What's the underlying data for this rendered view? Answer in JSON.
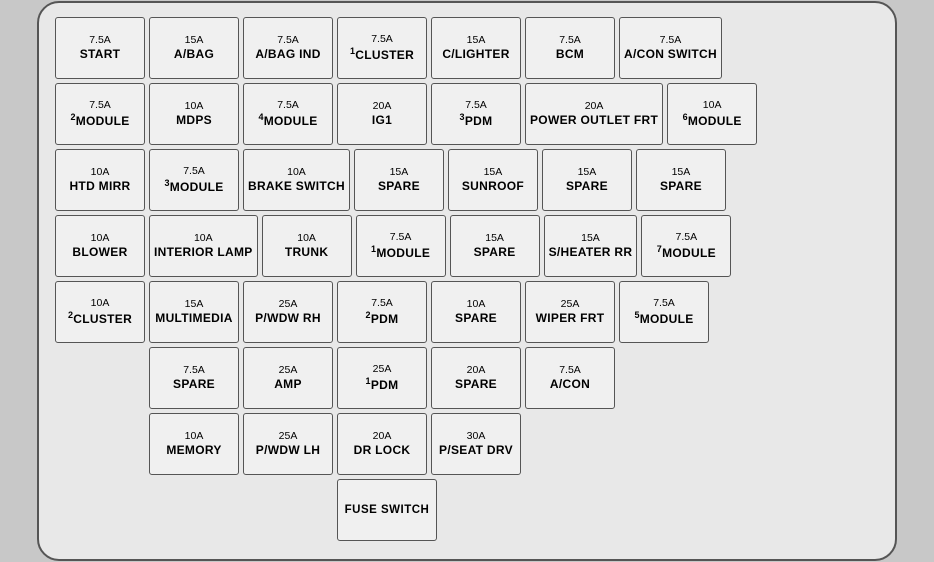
{
  "rows": [
    {
      "offset": 0,
      "cells": [
        {
          "amps": "7.5A",
          "label": "START",
          "sup": ""
        },
        {
          "amps": "15A",
          "label": "A/BAG",
          "sup": ""
        },
        {
          "amps": "7.5A",
          "label": "A/BAG IND",
          "sup": ""
        },
        {
          "amps": "7.5A",
          "label": "CLUSTER",
          "sup": "1"
        },
        {
          "amps": "15A",
          "label": "C/LIGHTER",
          "sup": ""
        },
        {
          "amps": "7.5A",
          "label": "BCM",
          "sup": ""
        },
        {
          "amps": "7.5A",
          "label": "A/CON SWITCH",
          "sup": ""
        }
      ]
    },
    {
      "offset": 0,
      "cells": [
        {
          "amps": "7.5A",
          "label": "MODULE",
          "sup": "2"
        },
        {
          "amps": "10A",
          "label": "MDPS",
          "sup": ""
        },
        {
          "amps": "7.5A",
          "label": "MODULE",
          "sup": "4"
        },
        {
          "amps": "20A",
          "label": "IG1",
          "sup": ""
        },
        {
          "amps": "7.5A",
          "label": "PDM",
          "sup": "3"
        },
        {
          "amps": "20A",
          "label": "POWER OUTLET FRT",
          "sup": ""
        },
        {
          "amps": "10A",
          "label": "MODULE",
          "sup": "6"
        }
      ]
    },
    {
      "offset": 0,
      "cells": [
        {
          "amps": "10A",
          "label": "HTD MIRR",
          "sup": ""
        },
        {
          "amps": "7.5A",
          "label": "MODULE",
          "sup": "3"
        },
        {
          "amps": "10A",
          "label": "BRAKE SWITCH",
          "sup": ""
        },
        {
          "amps": "15A",
          "label": "SPARE",
          "sup": ""
        },
        {
          "amps": "15A",
          "label": "SUNROOF",
          "sup": ""
        },
        {
          "amps": "15A",
          "label": "SPARE",
          "sup": ""
        },
        {
          "amps": "15A",
          "label": "SPARE",
          "sup": ""
        }
      ]
    },
    {
      "offset": 0,
      "cells": [
        {
          "amps": "10A",
          "label": "BLOWER",
          "sup": ""
        },
        {
          "amps": "10A",
          "label": "INTERIOR LAMP",
          "sup": ""
        },
        {
          "amps": "10A",
          "label": "TRUNK",
          "sup": ""
        },
        {
          "amps": "7.5A",
          "label": "MODULE",
          "sup": "1"
        },
        {
          "amps": "15A",
          "label": "SPARE",
          "sup": ""
        },
        {
          "amps": "15A",
          "label": "S/HEATER RR",
          "sup": ""
        },
        {
          "amps": "7.5A",
          "label": "MODULE",
          "sup": "7"
        }
      ]
    },
    {
      "offset": 0,
      "cells": [
        {
          "amps": "10A",
          "label": "CLUSTER",
          "sup": "2"
        },
        {
          "amps": "15A",
          "label": "MULTIMEDIA",
          "sup": ""
        },
        {
          "amps": "25A",
          "label": "P/WDW RH",
          "sup": ""
        },
        {
          "amps": "7.5A",
          "label": "PDM",
          "sup": "2"
        },
        {
          "amps": "10A",
          "label": "SPARE",
          "sup": ""
        },
        {
          "amps": "25A",
          "label": "WIPER FRT",
          "sup": ""
        },
        {
          "amps": "7.5A",
          "label": "MODULE",
          "sup": "5"
        }
      ]
    },
    {
      "offset": 1,
      "cells": [
        {
          "amps": "7.5A",
          "label": "SPARE",
          "sup": ""
        },
        {
          "amps": "25A",
          "label": "AMP",
          "sup": ""
        },
        {
          "amps": "25A",
          "label": "PDM",
          "sup": "1"
        },
        {
          "amps": "20A",
          "label": "SPARE",
          "sup": ""
        },
        {
          "amps": "7.5A",
          "label": "A/CON",
          "sup": ""
        }
      ]
    },
    {
      "offset": 1,
      "cells": [
        {
          "amps": "10A",
          "label": "MEMORY",
          "sup": ""
        },
        {
          "amps": "25A",
          "label": "P/WDW LH",
          "sup": ""
        },
        {
          "amps": "20A",
          "label": "DR LOCK",
          "sup": ""
        },
        {
          "amps": "30A",
          "label": "P/SEAT DRV",
          "sup": ""
        }
      ]
    }
  ],
  "fuse_switch": {
    "label": "FUSE SWITCH",
    "offset": 3
  }
}
